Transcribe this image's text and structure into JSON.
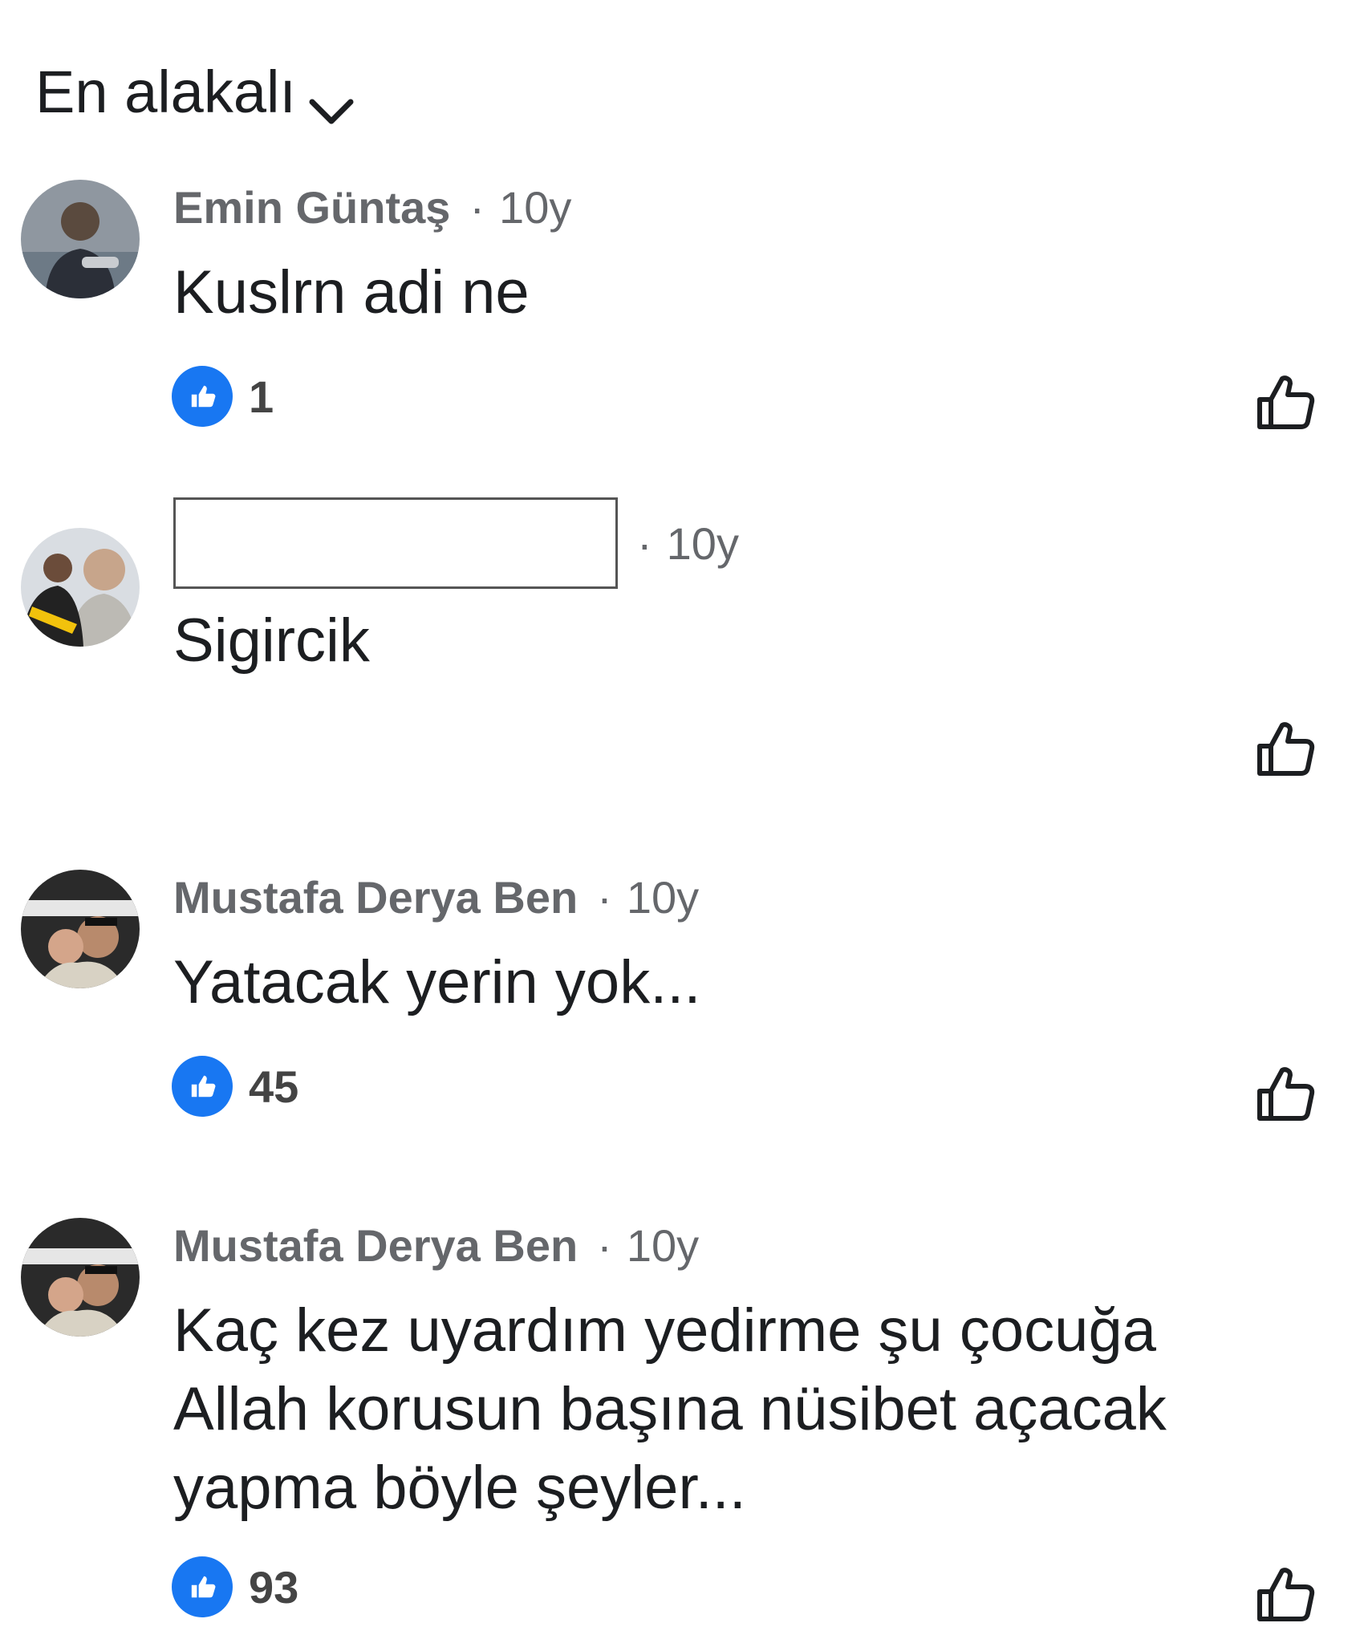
{
  "sort": {
    "label": "En alakalı"
  },
  "comments": [
    {
      "author": "Emin Güntaş",
      "time": "10y",
      "text": "Kuslrn adi ne",
      "likes": "1",
      "redacted": false
    },
    {
      "author": "",
      "time": "10y",
      "text": "Sigircik",
      "likes": "",
      "redacted": true
    },
    {
      "author": "Mustafa Derya Ben",
      "time": "10y",
      "text": "Yatacak yerin yok...",
      "likes": "45",
      "redacted": false
    },
    {
      "author": "Mustafa Derya Ben",
      "time": "10y",
      "text_lines": [
        "Kaç kez uyardım yedirme şu çocuğa",
        "Allah korusun başına nüsibet açacak",
        "yapma böyle şeyler..."
      ],
      "likes": "93",
      "redacted": false
    }
  ],
  "separator": "·",
  "icons": {
    "sort": "chevron-down-icon",
    "reaction": "like-reaction-icon",
    "like": "thumbs-up-outline-icon"
  },
  "colors": {
    "like_blue": "#1877f2",
    "meta_gray": "#65676b",
    "text": "#1c1e21"
  }
}
